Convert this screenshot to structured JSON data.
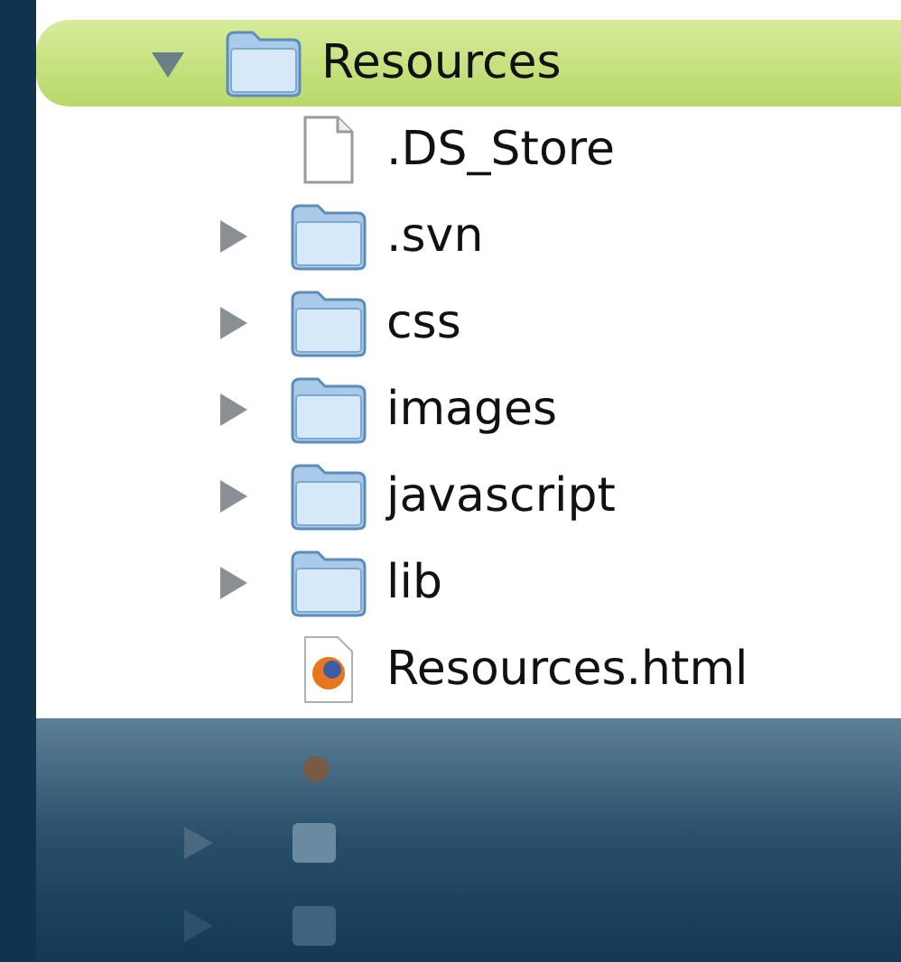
{
  "tree": [
    {
      "name": "Resources",
      "kind": "folder",
      "expanded": true,
      "selected": true,
      "children": [
        {
          "name": ".DS_Store",
          "kind": "file",
          "selected": false
        },
        {
          "name": ".svn",
          "kind": "folder",
          "expanded": false,
          "selected": false
        },
        {
          "name": "css",
          "kind": "folder",
          "expanded": false,
          "selected": false
        },
        {
          "name": "images",
          "kind": "folder",
          "expanded": false,
          "selected": false
        },
        {
          "name": "javascript",
          "kind": "folder",
          "expanded": false,
          "selected": false
        },
        {
          "name": "lib",
          "kind": "folder",
          "expanded": false,
          "selected": false
        },
        {
          "name": "Resources.html",
          "kind": "html",
          "selected": false
        }
      ]
    }
  ]
}
